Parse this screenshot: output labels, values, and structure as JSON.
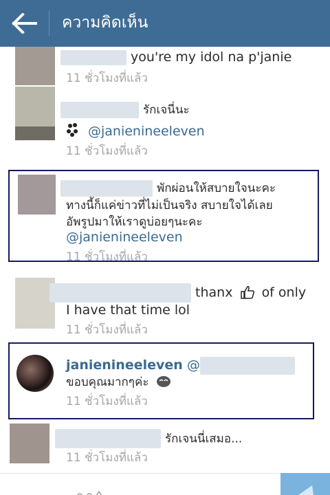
{
  "header": {
    "title": "ความคิดเห็น",
    "back_icon": "back-arrow-icon"
  },
  "colors": {
    "header_bg": "#3f6c94",
    "mention": "#3a6a91",
    "highlight_border": "#141a5c",
    "send_bg": "#7ab3dd"
  },
  "comments": [
    {
      "text": "you're my idol na p'janie",
      "time": "11 ชั่วโมงที่แล้ว"
    },
    {
      "text": "รักเจนี่นะ",
      "mention": "@janienineeleven",
      "icon": "paw-print-icon",
      "time": "11 ชั่วโมงที่แล้ว"
    },
    {
      "line1": "พักผ่อนให้สบายใจนะคะ",
      "line2": "ทางนี้ก็แค่ข่าวที่ไม่เป็นจริง สบายใจได้เลย",
      "line3": "อัพรูปมาให้เราดูบ่อยๆนะคะ",
      "mention": "@janienineeleven",
      "time": "11 ชั่วโมงที่แล้ว"
    },
    {
      "text_a": "thanx",
      "icon": "thumbs-up-icon",
      "text_b": "of only",
      "line2": "I have that time lol",
      "time": "11 ชั่วโมงที่แล้ว"
    },
    {
      "username": "janienineeleven",
      "at": "@",
      "text": "ขอบคุณมากๆค่ะ",
      "icon": "embarrassed-face-icon",
      "time": "11 ชั่วโมงที่แล้ว"
    },
    {
      "text": "รักเจนนี่เสมอ...",
      "time": "11 ชั่วโมงที่แล้ว"
    }
  ]
}
